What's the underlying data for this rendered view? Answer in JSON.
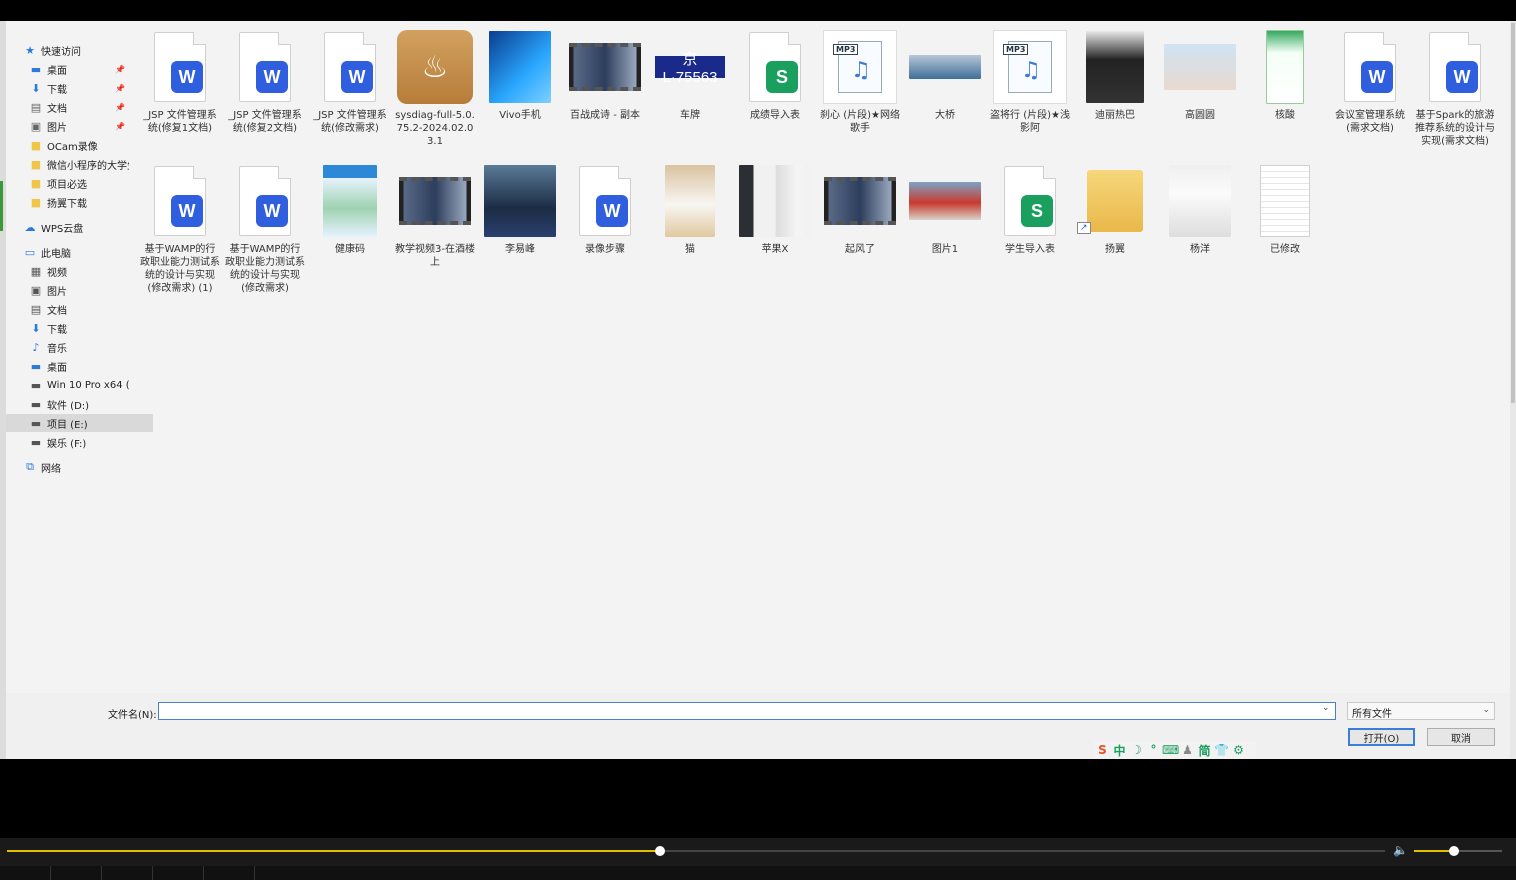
{
  "sidebar": {
    "items": [
      {
        "label": "快速访问",
        "icon": "star-icon",
        "color": "#2a7ae2",
        "pinned": false
      },
      {
        "label": "桌面",
        "icon": "desktop-icon",
        "color": "#2a7ae2",
        "pinned": true
      },
      {
        "label": "下载",
        "icon": "download-icon",
        "color": "#2a7ae2",
        "pinned": true
      },
      {
        "label": "文档",
        "icon": "document-icon",
        "color": "#666666",
        "pinned": true
      },
      {
        "label": "图片",
        "icon": "picture-icon",
        "color": "#666666",
        "pinned": true
      },
      {
        "label": "OCam录像",
        "icon": "folder-icon",
        "color": "#f0c64a",
        "pinned": false
      },
      {
        "label": "微信小程序的大学生",
        "icon": "folder-icon",
        "color": "#f0c64a",
        "pinned": false
      },
      {
        "label": "项目必选",
        "icon": "folder-icon",
        "color": "#f0c64a",
        "pinned": false
      },
      {
        "label": "扬翼下载",
        "icon": "folder-icon",
        "color": "#f0c64a",
        "pinned": false
      },
      {
        "label": "WPS云盘",
        "icon": "cloud-icon",
        "color": "#2a7ae2",
        "pinned": false
      },
      {
        "label": "此电脑",
        "icon": "computer-icon",
        "color": "#2a7ae2",
        "pinned": false
      },
      {
        "label": "视频",
        "icon": "video-icon",
        "color": "#555555",
        "pinned": false
      },
      {
        "label": "图片",
        "icon": "picture-icon",
        "color": "#555555",
        "pinned": false
      },
      {
        "label": "文档",
        "icon": "document-icon",
        "color": "#555555",
        "pinned": false
      },
      {
        "label": "下载",
        "icon": "download-icon",
        "color": "#2a7ae2",
        "pinned": false
      },
      {
        "label": "音乐",
        "icon": "music-icon",
        "color": "#2a7ae2",
        "pinned": false
      },
      {
        "label": "桌面",
        "icon": "desktop-icon",
        "color": "#2a7ae2",
        "pinned": false
      },
      {
        "label": "Win 10 Pro x64 (C",
        "icon": "drive-icon",
        "color": "#555555",
        "pinned": false
      },
      {
        "label": "软件 (D:)",
        "icon": "drive-icon",
        "color": "#555555",
        "pinned": false
      },
      {
        "label": "项目 (E:)",
        "icon": "drive-icon",
        "color": "#555555",
        "pinned": false,
        "selected": true
      },
      {
        "label": "娱乐 (F:)",
        "icon": "drive-icon",
        "color": "#555555",
        "pinned": false
      },
      {
        "label": "网络",
        "icon": "network-icon",
        "color": "#2a7ae2",
        "pinned": false
      }
    ]
  },
  "files": [
    {
      "name": "_JSP 文件管理系统(修复1文档)",
      "kind": "word"
    },
    {
      "name": "_JSP 文件管理系统(修复2文档)",
      "kind": "word"
    },
    {
      "name": "_JSP 文件管理系统(修改需求)",
      "kind": "word"
    },
    {
      "name": "sysdiag-full-5.0.75.2-2024.02.03.1",
      "kind": "installer"
    },
    {
      "name": "Vivo手机",
      "kind": "image"
    },
    {
      "name": "百战成诗 - 副本",
      "kind": "video"
    },
    {
      "name": "车牌",
      "kind": "plate",
      "plate_text": "京L·75563"
    },
    {
      "name": "成绩导入表",
      "kind": "sheet"
    },
    {
      "name": "刹心 (片段)★网络歌手",
      "kind": "mp3"
    },
    {
      "name": "大桥",
      "kind": "image"
    },
    {
      "name": "盗将行 (片段)★浅影阿",
      "kind": "mp3"
    },
    {
      "name": "迪丽热巴",
      "kind": "image"
    },
    {
      "name": "高圆圆",
      "kind": "image"
    },
    {
      "name": "核酸",
      "kind": "image"
    },
    {
      "name": "会议室管理系统(需求文档)",
      "kind": "word"
    },
    {
      "name": "基于Spark的旅游推荐系统的设计与实现(需求文档)",
      "kind": "word"
    },
    {
      "name": "基于WAMP的行政职业能力测试系统的设计与实现(修改需求) (1)",
      "kind": "word"
    },
    {
      "name": "基于WAMP的行政职业能力测试系统的设计与实现(修改需求)",
      "kind": "word"
    },
    {
      "name": "健康码",
      "kind": "image"
    },
    {
      "name": "教学视频3-在酒楼上",
      "kind": "video"
    },
    {
      "name": "李易峰",
      "kind": "image"
    },
    {
      "name": "录像步骤",
      "kind": "word"
    },
    {
      "name": "猫",
      "kind": "image"
    },
    {
      "name": "苹果X",
      "kind": "image"
    },
    {
      "name": "起风了",
      "kind": "video"
    },
    {
      "name": "图片1",
      "kind": "image"
    },
    {
      "name": "学生导入表",
      "kind": "sheet"
    },
    {
      "name": "扬翼",
      "kind": "folder"
    },
    {
      "name": "杨洋",
      "kind": "image"
    },
    {
      "name": "已修改",
      "kind": "blank"
    }
  ],
  "bottom": {
    "filename_label": "文件名(N):",
    "filename_value": "",
    "filetype_value": "所有文件",
    "open_label": "打开(O)",
    "cancel_label": "取消"
  },
  "ime": {
    "items": [
      "S",
      "中",
      "☽",
      "°",
      "⌨",
      "♟",
      "简",
      "👕",
      "⚙"
    ]
  },
  "player": {
    "progress": 0.474,
    "volume": 0.45
  },
  "colors": {
    "word": "#2f5fdf",
    "sheet": "#1a9f5e",
    "accent": "#e2c000",
    "selection": "#3c7ed6"
  }
}
